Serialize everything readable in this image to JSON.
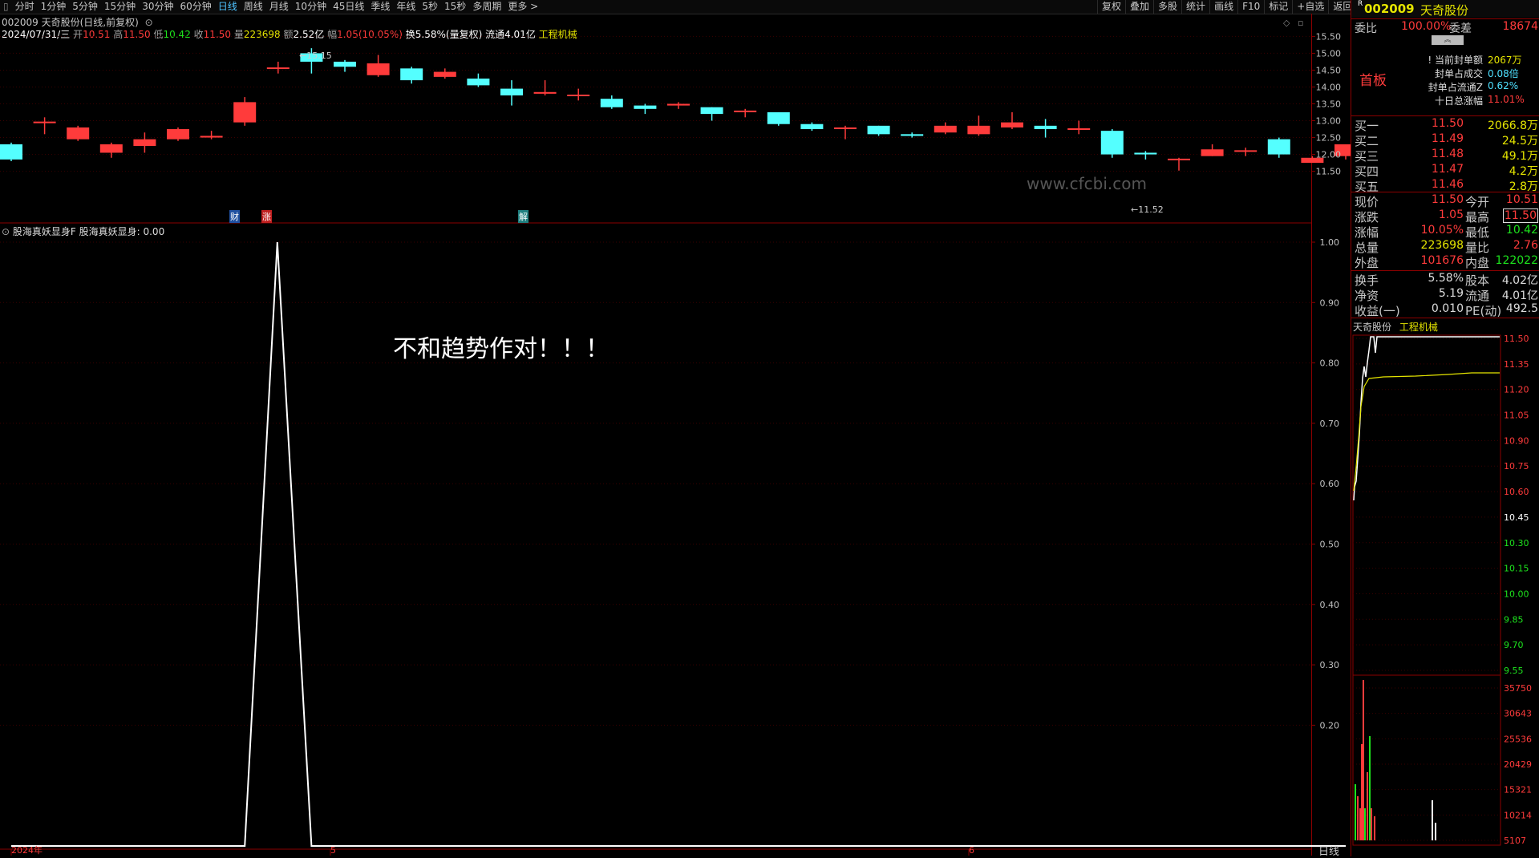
{
  "toolbar": {
    "left_items": [
      {
        "label": "分时",
        "active": false
      },
      {
        "label": "1分钟",
        "active": false
      },
      {
        "label": "5分钟",
        "active": false
      },
      {
        "label": "15分钟",
        "active": false
      },
      {
        "label": "30分钟",
        "active": false
      },
      {
        "label": "60分钟",
        "active": false
      },
      {
        "label": "日线",
        "active": true
      },
      {
        "label": "周线",
        "active": false
      },
      {
        "label": "月线",
        "active": false
      },
      {
        "label": "10分钟",
        "active": false
      },
      {
        "label": "45日线",
        "active": false
      },
      {
        "label": "季线",
        "active": false
      },
      {
        "label": "年线",
        "active": false
      },
      {
        "label": "5秒",
        "active": false
      },
      {
        "label": "15秒",
        "active": false
      },
      {
        "label": "多周期",
        "active": false
      },
      {
        "label": "更多 >",
        "active": false
      }
    ],
    "right_items": [
      "复权",
      "叠加",
      "多股",
      "统计",
      "画线",
      "F10",
      "标记",
      "+自选",
      "返回"
    ]
  },
  "header": {
    "stock_line": "002009 天奇股份(日线,前复权)",
    "date": "2024/07/31/三",
    "open_label": "开",
    "open": "10.51",
    "high_label": "高",
    "high": "11.50",
    "low_label": "低",
    "low": "10.42",
    "close_label": "收",
    "close": "11.50",
    "vol_label": "量",
    "vol": "223698",
    "amt_label": "额",
    "amt": "2.52亿",
    "chg_label": "幅",
    "chg": "1.05(10.05%)",
    "turnover": "换5.58%(量复权)",
    "float": "流通4.01亿",
    "sector": "工程机械"
  },
  "kline": {
    "price_axis": [
      "15.50",
      "15.00",
      "14.50",
      "14.00",
      "13.50",
      "13.00",
      "12.50",
      "12.00",
      "11.50"
    ],
    "max_label": "15.15",
    "min_label": "11.52",
    "markers": [
      "财",
      "涨",
      "解"
    ],
    "watermark": "www.cfcbi.com"
  },
  "chart_data": {
    "type": "candlestick",
    "price_range": [
      11.3,
      15.7
    ],
    "candles": [
      {
        "o": 12.3,
        "c": 11.85,
        "h": 12.35,
        "l": 11.8
      },
      {
        "o": 12.95,
        "c": 12.95,
        "h": 13.1,
        "l": 12.6
      },
      {
        "o": 12.45,
        "c": 12.8,
        "h": 12.85,
        "l": 12.4
      },
      {
        "o": 12.05,
        "c": 12.3,
        "h": 12.35,
        "l": 11.9
      },
      {
        "o": 12.25,
        "c": 12.45,
        "h": 12.65,
        "l": 12.05
      },
      {
        "o": 12.45,
        "c": 12.75,
        "h": 12.8,
        "l": 12.4
      },
      {
        "o": 12.5,
        "c": 12.55,
        "h": 12.7,
        "l": 12.45
      },
      {
        "o": 12.95,
        "c": 13.55,
        "h": 13.7,
        "l": 12.85
      },
      {
        "o": 14.55,
        "c": 14.58,
        "h": 14.75,
        "l": 14.4
      },
      {
        "o": 15.0,
        "c": 14.75,
        "h": 15.15,
        "l": 14.4
      },
      {
        "o": 14.75,
        "c": 14.6,
        "h": 14.8,
        "l": 14.45
      },
      {
        "o": 14.35,
        "c": 14.7,
        "h": 14.95,
        "l": 14.3
      },
      {
        "o": 14.55,
        "c": 14.2,
        "h": 14.6,
        "l": 14.1
      },
      {
        "o": 14.3,
        "c": 14.45,
        "h": 14.55,
        "l": 14.25
      },
      {
        "o": 14.25,
        "c": 14.05,
        "h": 14.4,
        "l": 14.0
      },
      {
        "o": 13.95,
        "c": 13.75,
        "h": 14.2,
        "l": 13.45
      },
      {
        "o": 13.8,
        "c": 13.85,
        "h": 14.2,
        "l": 13.75
      },
      {
        "o": 13.75,
        "c": 13.75,
        "h": 13.95,
        "l": 13.6
      },
      {
        "o": 13.65,
        "c": 13.4,
        "h": 13.75,
        "l": 13.35
      },
      {
        "o": 13.45,
        "c": 13.35,
        "h": 13.5,
        "l": 13.2
      },
      {
        "o": 13.45,
        "c": 13.5,
        "h": 13.55,
        "l": 13.35
      },
      {
        "o": 13.4,
        "c": 13.2,
        "h": 13.4,
        "l": 13.0
      },
      {
        "o": 13.25,
        "c": 13.3,
        "h": 13.35,
        "l": 13.1
      },
      {
        "o": 13.25,
        "c": 12.9,
        "h": 13.25,
        "l": 12.85
      },
      {
        "o": 12.9,
        "c": 12.75,
        "h": 12.95,
        "l": 12.7
      },
      {
        "o": 12.75,
        "c": 12.8,
        "h": 12.85,
        "l": 12.45
      },
      {
        "o": 12.85,
        "c": 12.6,
        "h": 12.85,
        "l": 12.55
      },
      {
        "o": 12.6,
        "c": 12.55,
        "h": 12.65,
        "l": 12.5
      },
      {
        "o": 12.65,
        "c": 12.85,
        "h": 12.95,
        "l": 12.6
      },
      {
        "o": 12.6,
        "c": 12.85,
        "h": 13.15,
        "l": 12.55
      },
      {
        "o": 12.8,
        "c": 12.95,
        "h": 13.25,
        "l": 12.75
      },
      {
        "o": 12.85,
        "c": 12.75,
        "h": 13.05,
        "l": 12.5
      },
      {
        "o": 12.75,
        "c": 12.75,
        "h": 13.0,
        "l": 12.6
      },
      {
        "o": 12.7,
        "c": 12.0,
        "h": 12.75,
        "l": 11.9
      },
      {
        "o": 12.05,
        "c": 12.0,
        "h": 12.1,
        "l": 11.85
      },
      {
        "o": 11.85,
        "c": 11.85,
        "h": 11.9,
        "l": 11.52
      },
      {
        "o": 11.95,
        "c": 12.15,
        "h": 12.3,
        "l": 11.95
      },
      {
        "o": 12.1,
        "c": 12.1,
        "h": 12.2,
        "l": 11.95
      },
      {
        "o": 12.45,
        "c": 12.0,
        "h": 12.5,
        "l": 11.9
      },
      {
        "o": 11.75,
        "c": 11.9,
        "h": 11.95,
        "l": 11.75
      },
      {
        "o": 11.95,
        "c": 12.3,
        "h": 12.3,
        "l": 11.85
      }
    ],
    "indicator": {
      "name": "股海真妖显身F",
      "series_label": "股海真妖显身: 0.00",
      "yaxis": [
        "1.00",
        "0.90",
        "0.80",
        "0.70",
        "0.60",
        "0.50",
        "0.40",
        "0.30",
        "0.20"
      ],
      "ylim": [
        0.0,
        1.0
      ],
      "values": [
        0,
        0,
        0,
        0,
        0,
        0,
        0,
        0,
        1,
        0,
        0,
        0,
        0,
        0,
        0,
        0,
        0,
        0,
        0,
        0,
        0,
        0,
        0,
        0,
        0,
        0,
        0,
        0,
        0,
        0,
        0,
        0,
        0,
        0,
        0,
        0,
        0,
        0,
        0,
        0,
        0
      ]
    },
    "x_labels": [
      "2024年",
      "5",
      "6"
    ]
  },
  "annotation": "不和趋势作对！！！",
  "bottom_tab": "日线",
  "right_panel": {
    "code": "002009",
    "name": "天奇股份",
    "r_tag": "R",
    "weibi_label": "委比",
    "weibi": "100.00%",
    "weicha_label": "委差",
    "weicha": "18674",
    "first_board": "首板",
    "seal_rows": [
      {
        "label": "当前封单额",
        "value": "2067万"
      },
      {
        "label": "封单占成交",
        "value": "0.08倍"
      },
      {
        "label": "封单占流通Z",
        "value": "0.62%"
      },
      {
        "label": "十日总涨幅",
        "value": "11.01%"
      }
    ],
    "buys": [
      {
        "label": "买一",
        "price": "11.50",
        "vol": "2066.8万"
      },
      {
        "label": "买二",
        "price": "11.49",
        "vol": "24.5万"
      },
      {
        "label": "买三",
        "price": "11.48",
        "vol": "49.1万"
      },
      {
        "label": "买四",
        "price": "11.47",
        "vol": "4.2万"
      },
      {
        "label": "买五",
        "price": "11.46",
        "vol": "2.8万"
      }
    ],
    "quote_rows": [
      {
        "l1": "现价",
        "v1": "11.50",
        "l2": "今开",
        "v2": "10.51"
      },
      {
        "l1": "涨跌",
        "v1": "1.05",
        "l2": "最高",
        "v2": "11.50"
      },
      {
        "l1": "涨幅",
        "v1": "10.05%",
        "l2": "最低",
        "v2": "10.42"
      },
      {
        "l1": "总量",
        "v1": "223698",
        "l2": "量比",
        "v2": "2.76"
      },
      {
        "l1": "外盘",
        "v1": "101676",
        "l2": "内盘",
        "v2": "122022"
      }
    ],
    "quote_rows2": [
      {
        "l1": "换手",
        "v1": "5.58%",
        "l2": "股本",
        "v2": "4.02亿"
      },
      {
        "l1": "净资",
        "v1": "5.19",
        "l2": "流通",
        "v2": "4.01亿"
      },
      {
        "l1": "收益(一)",
        "v1": "0.010",
        "l2": "PE(动)",
        "v2": "492.5"
      }
    ],
    "mini_title": "天奇股份",
    "mini_sector": "工程机械",
    "mini_price_axis": [
      "11.50",
      "11.35",
      "11.20",
      "11.05",
      "10.90",
      "10.75",
      "10.60",
      "10.45",
      "10.30",
      "10.15",
      "10.00",
      "9.85",
      "9.70",
      "9.55"
    ],
    "mini_vol_axis": [
      "35750",
      "30643",
      "25536",
      "20429",
      "15321",
      "10214",
      "5107"
    ]
  }
}
